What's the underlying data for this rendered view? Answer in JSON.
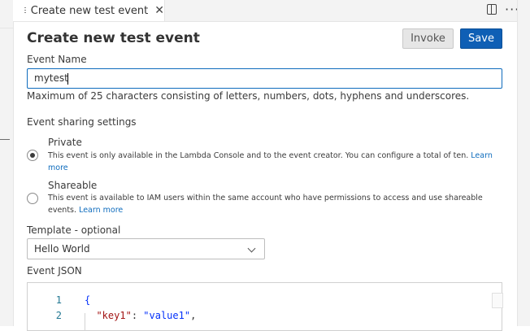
{
  "tab": {
    "title": "Create new test event",
    "close_glyph": "✕"
  },
  "toolbar": {
    "more_glyph": "···"
  },
  "header": {
    "title": "Create new test event",
    "invoke_label": "Invoke",
    "save_label": "Save",
    "save_color": "#0f5fb5"
  },
  "event_name": {
    "label": "Event Name",
    "value": "mytest",
    "hint": "Maximum of 25 characters consisting of letters, numbers, dots, hyphens and underscores."
  },
  "sharing": {
    "heading": "Event sharing settings",
    "options": [
      {
        "title": "Private",
        "description": "This event is only available in the Lambda Console and to the event creator. You can configure a total of ten.",
        "link": "Learn more",
        "selected": true
      },
      {
        "title": "Shareable",
        "description": "This event is available to IAM users within the same account who have permissions to access and use shareable events.",
        "link": "Learn more",
        "selected": false
      }
    ]
  },
  "template": {
    "label": "Template - optional",
    "selected": "Hello World"
  },
  "event_json": {
    "label": "Event JSON",
    "lines": [
      {
        "number": "1",
        "brace": "{"
      },
      {
        "number": "2",
        "key": "\"key1\"",
        "colon": ": ",
        "value": "\"value1\"",
        "comma": ","
      }
    ]
  }
}
